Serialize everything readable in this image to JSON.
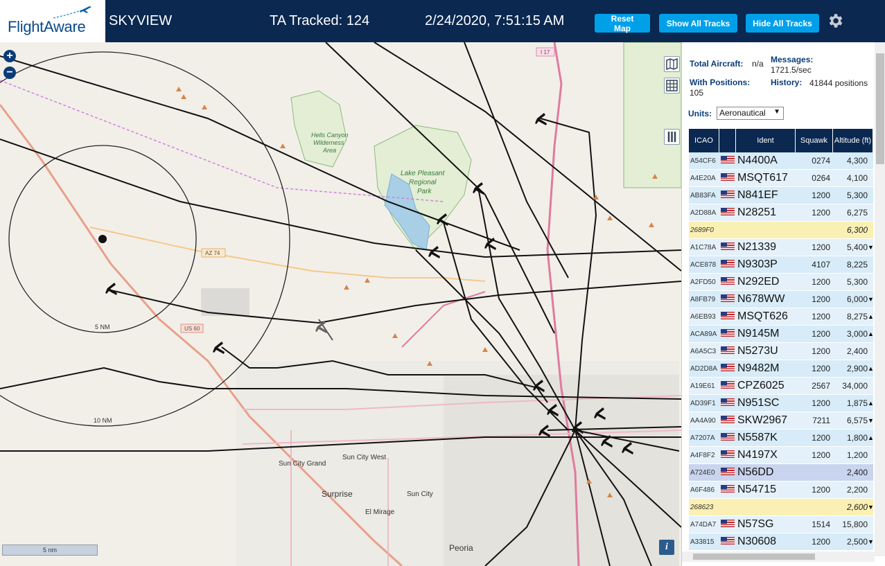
{
  "header": {
    "logo": "FlightAware",
    "title": "SKYVIEW",
    "tracked": "TA Tracked: 124",
    "datetime": "2/24/2020, 7:51:15 AM",
    "buttons": {
      "reset": "Reset Map",
      "show": "Show All Tracks",
      "hide": "Hide All Tracks"
    }
  },
  "map": {
    "scale": "5 nm",
    "range_rings": [
      "5 NM",
      "10 NM"
    ],
    "labels": {
      "canyon": "Hells Canyon Wilderness Area",
      "lake": "Lake Pleasant Regional Park",
      "sun_city_grand": "Sun City Grand",
      "sun_city_west": "Sun City West",
      "surprise": "Surprise",
      "sun_city": "Sun City",
      "el_mirage": "El Mirage",
      "peoria": "Peoria",
      "az74": "AZ 74",
      "us60": "US 60",
      "i17": "I 17"
    }
  },
  "stats": {
    "total_label": "Total Aircraft:",
    "total_val": "n/a",
    "with_pos_label": "With Positions:",
    "with_pos_val": "105",
    "messages_label": "Messages:",
    "messages_val": "1721.5/sec",
    "history_label": "History:",
    "history_val": "41844 positions",
    "units_label": "Units:",
    "units_val": "Aeronautical"
  },
  "table": {
    "headers": [
      "ICAO",
      "",
      "Ident",
      "Squawk",
      "Altitude (ft)"
    ],
    "rows": [
      {
        "icao": "A54CF6",
        "ident": "N4400A",
        "squawk": "0274",
        "alt": "4,300",
        "dir": "",
        "style": "norm"
      },
      {
        "icao": "A4E20A",
        "ident": "MSQT617",
        "squawk": "0264",
        "alt": "4,100",
        "dir": "",
        "style": "alt"
      },
      {
        "icao": "AB83FA",
        "ident": "N841EF",
        "squawk": "1200",
        "alt": "5,300",
        "dir": "",
        "style": "norm"
      },
      {
        "icao": "A2D88A",
        "ident": "N28251",
        "squawk": "1200",
        "alt": "6,275",
        "dir": "",
        "style": "alt"
      },
      {
        "icao": "2689F0",
        "ident": "",
        "squawk": "",
        "alt": "6,300",
        "dir": "",
        "style": "yellow"
      },
      {
        "icao": "A1C78A",
        "ident": "N21339",
        "squawk": "1200",
        "alt": "5,400",
        "dir": "▼",
        "style": "alt"
      },
      {
        "icao": "ACE878",
        "ident": "N9303P",
        "squawk": "4107",
        "alt": "8,225",
        "dir": "",
        "style": "norm"
      },
      {
        "icao": "A2FD50",
        "ident": "N292ED",
        "squawk": "1200",
        "alt": "5,300",
        "dir": "",
        "style": "alt"
      },
      {
        "icao": "A8FB79",
        "ident": "N678WW",
        "squawk": "1200",
        "alt": "6,000",
        "dir": "▼",
        "style": "norm"
      },
      {
        "icao": "A6EB93",
        "ident": "MSQT626",
        "squawk": "1200",
        "alt": "8,275",
        "dir": "▲",
        "style": "alt"
      },
      {
        "icao": "ACA89A",
        "ident": "N9145M",
        "squawk": "1200",
        "alt": "3,000",
        "dir": "▲",
        "style": "norm"
      },
      {
        "icao": "A6A5C3",
        "ident": "N5273U",
        "squawk": "1200",
        "alt": "2,400",
        "dir": "",
        "style": "alt"
      },
      {
        "icao": "AD2D8A",
        "ident": "N9482M",
        "squawk": "1200",
        "alt": "2,900",
        "dir": "▲",
        "style": "norm"
      },
      {
        "icao": "A19E61",
        "ident": "CPZ6025",
        "squawk": "2567",
        "alt": "34,000",
        "dir": "",
        "style": "alt"
      },
      {
        "icao": "AD39F1",
        "ident": "N951SC",
        "squawk": "1200",
        "alt": "1,875",
        "dir": "▲",
        "style": "norm"
      },
      {
        "icao": "AA4A90",
        "ident": "SKW2967",
        "squawk": "7211",
        "alt": "6,575",
        "dir": "▼",
        "style": "alt"
      },
      {
        "icao": "A7207A",
        "ident": "N5587K",
        "squawk": "1200",
        "alt": "1,800",
        "dir": "▲",
        "style": "norm"
      },
      {
        "icao": "A4F8F2",
        "ident": "N4197X",
        "squawk": "1200",
        "alt": "1,200",
        "dir": "",
        "style": "alt"
      },
      {
        "icao": "A724E0",
        "ident": "N56DD",
        "squawk": "",
        "alt": "2,400",
        "dir": "",
        "style": "sel"
      },
      {
        "icao": "A6F486",
        "ident": "N54715",
        "squawk": "1200",
        "alt": "2,200",
        "dir": "",
        "style": "alt"
      },
      {
        "icao": "268623",
        "ident": "",
        "squawk": "",
        "alt": "2,600",
        "dir": "▼",
        "style": "yellow"
      },
      {
        "icao": "A74DA7",
        "ident": "N57SG",
        "squawk": "1514",
        "alt": "15,800",
        "dir": "",
        "style": "alt"
      },
      {
        "icao": "A33815",
        "ident": "N30608",
        "squawk": "1200",
        "alt": "2,500",
        "dir": "▼",
        "style": "norm"
      }
    ]
  }
}
